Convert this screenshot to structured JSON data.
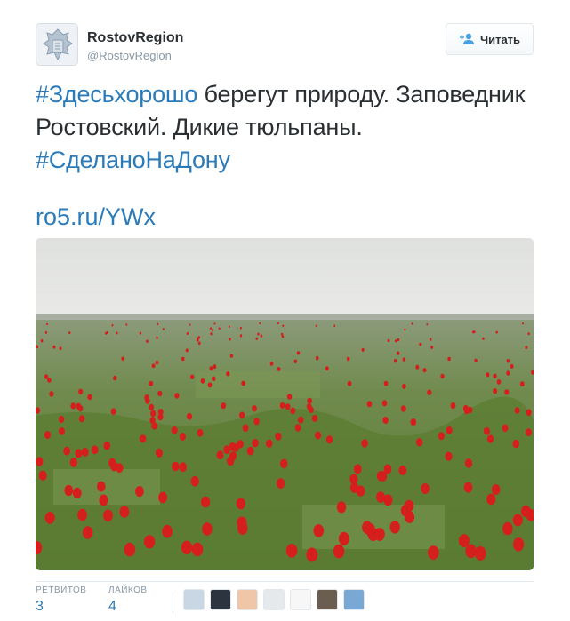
{
  "user": {
    "name": "RostovRegion",
    "handle": "@RostovRegion"
  },
  "follow_button": {
    "label": "Читать"
  },
  "tweet": {
    "text_parts": [
      {
        "type": "hashtag",
        "text": "#Здесьхорошо"
      },
      {
        "type": "text",
        "text": " берегут природу. Заповедник Ростовский. Дикие тюльпаны. "
      },
      {
        "type": "hashtag",
        "text": "#СделаноНаДону"
      }
    ],
    "link": "ro5.ru/YWx"
  },
  "stats": {
    "retweets_label": "РЕТВИТОВ",
    "retweets_count": "3",
    "likes_label": "ЛАЙКОВ",
    "likes_count": "4"
  },
  "colors": {
    "link": "#2b7bb9",
    "text": "#292f33",
    "muted": "#8899a6"
  },
  "likers": [
    {
      "name": "liker-avatar-pravo"
    },
    {
      "name": "liker-avatar-logo"
    },
    {
      "name": "liker-avatar-person"
    },
    {
      "name": "liker-avatar-egg"
    },
    {
      "name": "liker-avatar-emblem"
    },
    {
      "name": "liker-avatar-building"
    },
    {
      "name": "liker-avatar-banner"
    }
  ]
}
